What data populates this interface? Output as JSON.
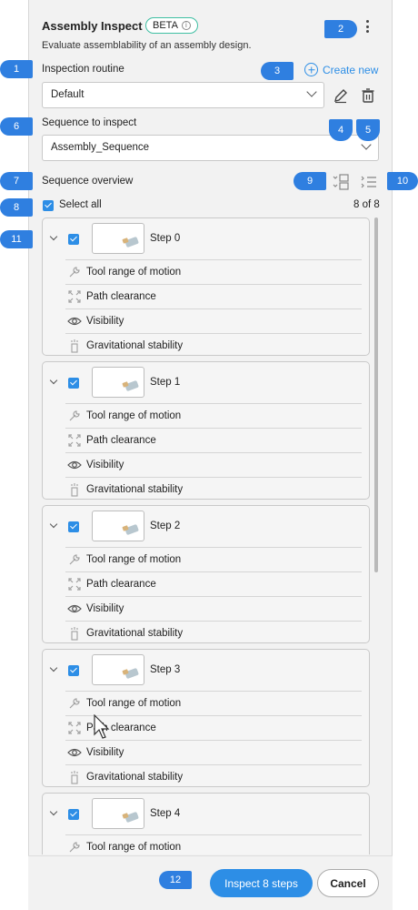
{
  "header": {
    "title": "Assembly Inspect",
    "beta_badge": "BETA",
    "subtitle": "Evaluate assemblability of an assembly design."
  },
  "inspection_routine": {
    "label": "Inspection routine",
    "selected": "Default",
    "create_new_label": "Create new"
  },
  "sequence": {
    "label": "Sequence to inspect",
    "selected": "Assembly_Sequence"
  },
  "overview": {
    "label": "Sequence overview",
    "select_all_label": "Select all",
    "count_text": "8 of 8"
  },
  "steps": [
    {
      "name": "Step 0",
      "checked": true,
      "checks": [
        "Tool range of motion",
        "Path clearance",
        "Visibility",
        "Gravitational stability"
      ]
    },
    {
      "name": "Step 1",
      "checked": true,
      "checks": [
        "Tool range of motion",
        "Path clearance",
        "Visibility",
        "Gravitational stability"
      ]
    },
    {
      "name": "Step 2",
      "checked": true,
      "checks": [
        "Tool range of motion",
        "Path clearance",
        "Visibility",
        "Gravitational stability"
      ]
    },
    {
      "name": "Step 3",
      "checked": true,
      "checks": [
        "Tool range of motion",
        "Path clearance",
        "Visibility",
        "Gravitational stability"
      ]
    },
    {
      "name": "Step 4",
      "checked": true,
      "checks": [
        "Tool range of motion"
      ]
    }
  ],
  "footer": {
    "primary_label": "Inspect 8 steps",
    "secondary_label": "Cancel"
  },
  "callouts": [
    "1",
    "2",
    "3",
    "4",
    "5",
    "6",
    "7",
    "8",
    "9",
    "10",
    "11",
    "12"
  ],
  "colors": {
    "accent": "#2d8ee6",
    "callout": "#2f7fe0",
    "beta_border": "#3fbfa3"
  }
}
